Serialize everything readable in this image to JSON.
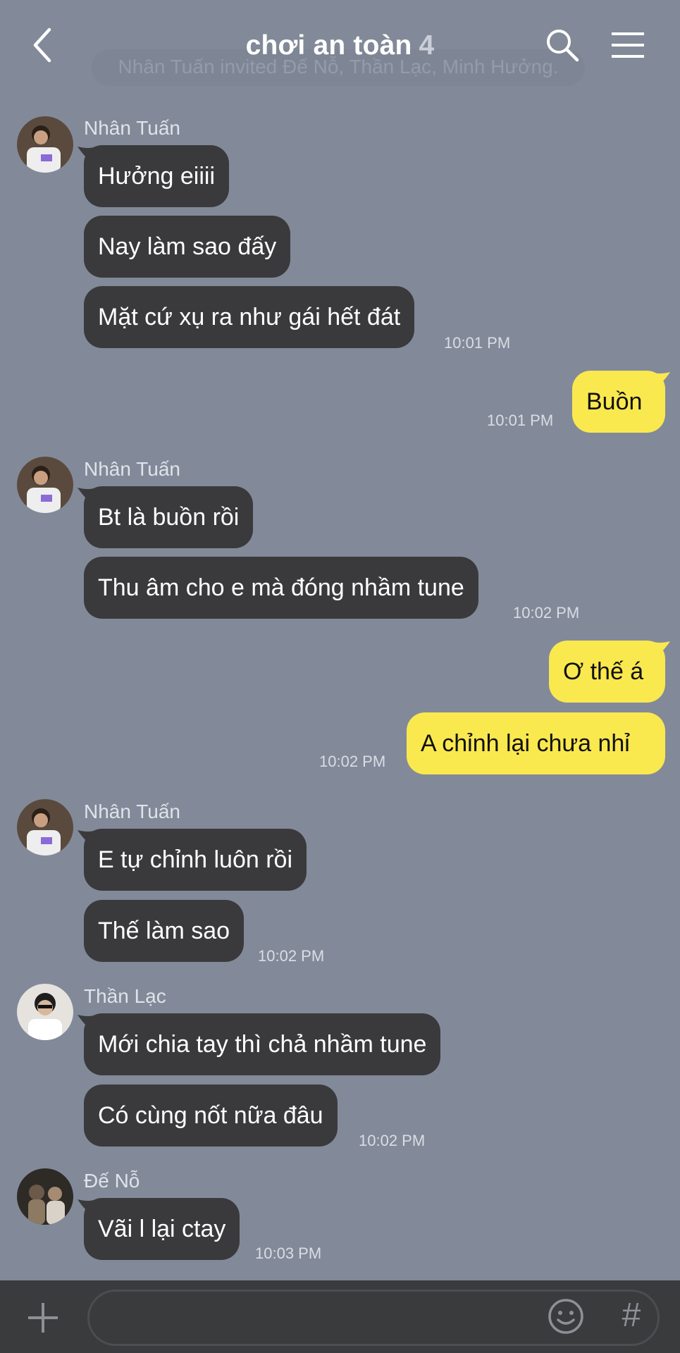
{
  "header": {
    "title": "chơi an toàn",
    "member_count": "4",
    "back_icon": "chevron-left-icon",
    "search_icon": "search-icon",
    "menu_icon": "hamburger-menu-icon"
  },
  "system_notice": "Nhân Tuấn invited Đế Nỗ, Thần Lạc, Minh Hưởng.",
  "messages": {
    "g1": {
      "sender": "Nhân Tuấn",
      "m1": "Hưởng eiiii",
      "m2": "Nay làm sao đấy",
      "m3": "Mặt cứ xụ ra như gái hết đát",
      "time": "10:01 PM"
    },
    "o1": {
      "m1": "Buồn",
      "time": "10:01 PM"
    },
    "g2": {
      "sender": "Nhân Tuấn",
      "m1": "Bt là buồn rồi",
      "m2": "Thu âm cho e mà đóng nhầm tune",
      "time": "10:02 PM"
    },
    "o2": {
      "m1": "Ơ thế á",
      "m2": "A chỉnh lại chưa nhỉ",
      "time": "10:02 PM"
    },
    "g3": {
      "sender": "Nhân Tuấn",
      "m1": "E tự chỉnh luôn rồi",
      "m2": "Thế làm sao",
      "time": "10:02 PM"
    },
    "g4": {
      "sender": "Thần Lạc",
      "m1": "Mới chia tay thì chả nhầm tune",
      "m2": "Có cùng nốt nữa đâu",
      "time": "10:02 PM"
    },
    "g5": {
      "sender": "Đế Nỗ",
      "m1": "Vãi l lại ctay",
      "time": "10:03 PM"
    }
  },
  "footer": {
    "input_value": "",
    "plus_icon": "plus-icon",
    "emoji_icon": "emoji-icon",
    "hashtag_icon": "hashtag-icon",
    "hashtag_glyph": "#"
  },
  "colors": {
    "background": "#828a99",
    "incoming_bubble": "#3a3a3c",
    "outgoing_bubble": "#fae84f",
    "footer": "#3a3b3d"
  }
}
